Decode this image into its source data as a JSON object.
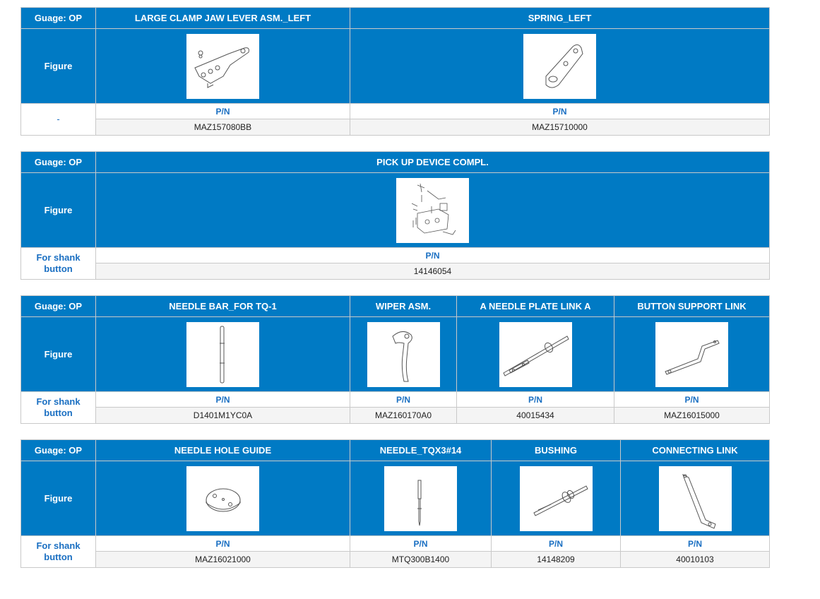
{
  "blocks": [
    {
      "gauge": "Guage: OP",
      "figure_label": "Figure",
      "side_text": "-",
      "parts": [
        {
          "name": "LARGE CLAMP JAW LEVER ASM._LEFT",
          "pn_label": "P/N",
          "pn": "MAZ157080BB",
          "icon": "clamp-jaw-lever-icon"
        },
        {
          "name": "SPRING_LEFT",
          "pn_label": "P/N",
          "pn": "MAZ15710000",
          "icon": "spring-plate-icon"
        }
      ]
    },
    {
      "gauge": "Guage: OP",
      "figure_label": "Figure",
      "side_text": "For shank button",
      "parts": [
        {
          "name": "PICK UP DEVICE COMPL.",
          "pn_label": "P/N",
          "pn": "14146054",
          "icon": "pick-up-device-icon"
        }
      ]
    },
    {
      "gauge": "Guage: OP",
      "figure_label": "Figure",
      "side_text": "For shank button",
      "parts": [
        {
          "name": "NEEDLE BAR_FOR TQ-1",
          "pn_label": "P/N",
          "pn": "D1401M1YC0A",
          "icon": "needle-bar-icon"
        },
        {
          "name": "WIPER ASM.",
          "pn_label": "P/N",
          "pn": "MAZ160170A0",
          "icon": "wiper-icon"
        },
        {
          "name": "A NEEDLE PLATE LINK A",
          "pn_label": "P/N",
          "pn": "40015434",
          "icon": "needle-plate-link-icon"
        },
        {
          "name": "BUTTON SUPPORT LINK",
          "pn_label": "P/N",
          "pn": "MAZ16015000",
          "icon": "support-link-icon"
        }
      ]
    },
    {
      "gauge": "Guage: OP",
      "figure_label": "Figure",
      "side_text": "For shank button",
      "parts": [
        {
          "name": "NEEDLE HOLE GUIDE",
          "pn_label": "P/N",
          "pn": "MAZ16021000",
          "icon": "needle-hole-guide-icon"
        },
        {
          "name": "NEEDLE_TQX3#14",
          "pn_label": "P/N",
          "pn": "MTQ300B1400",
          "icon": "needle-icon"
        },
        {
          "name": "BUSHING",
          "pn_label": "P/N",
          "pn": "14148209",
          "icon": "bushing-icon"
        },
        {
          "name": "CONNECTING LINK",
          "pn_label": "P/N",
          "pn": "40010103",
          "icon": "connecting-link-icon"
        }
      ]
    }
  ]
}
